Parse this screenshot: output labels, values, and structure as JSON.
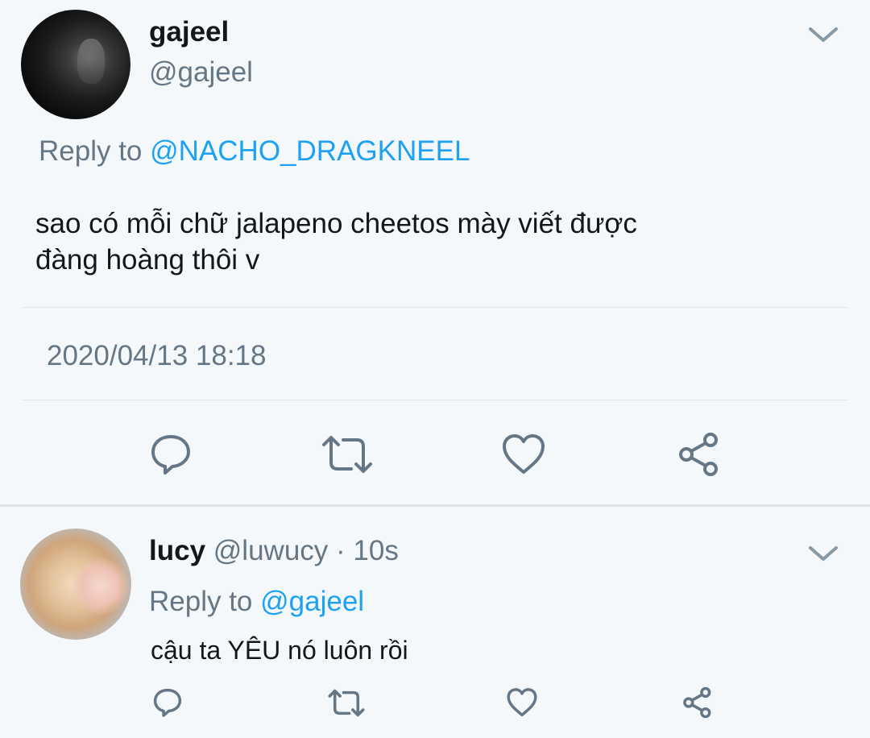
{
  "main_tweet": {
    "display_name": "gajeel",
    "handle": "@gajeel",
    "reply_prefix": "Reply to ",
    "reply_mention": "@NACHO_DRAGKNEEL",
    "text_line1": "sao có mỗi chữ jalapeno cheetos mày viết được",
    "text_line2": "đàng hoàng thôi v",
    "timestamp": "2020/04/13 18:18"
  },
  "reply_tweet": {
    "display_name": "lucy",
    "handle": "@luwucy",
    "separator": " · ",
    "time_ago": "10s",
    "reply_prefix": "Reply to ",
    "reply_mention": "@gajeel",
    "text": "cậu ta YÊU nó luôn rồi"
  },
  "icons": {
    "menu": "chevron-down-icon",
    "reply": "comment-icon",
    "retweet": "retweet-icon",
    "like": "heart-icon",
    "share": "share-icon"
  },
  "colors": {
    "background": "#f5f8fa",
    "text_primary": "#14171a",
    "text_secondary": "#657786",
    "accent": "#1da1f2"
  }
}
